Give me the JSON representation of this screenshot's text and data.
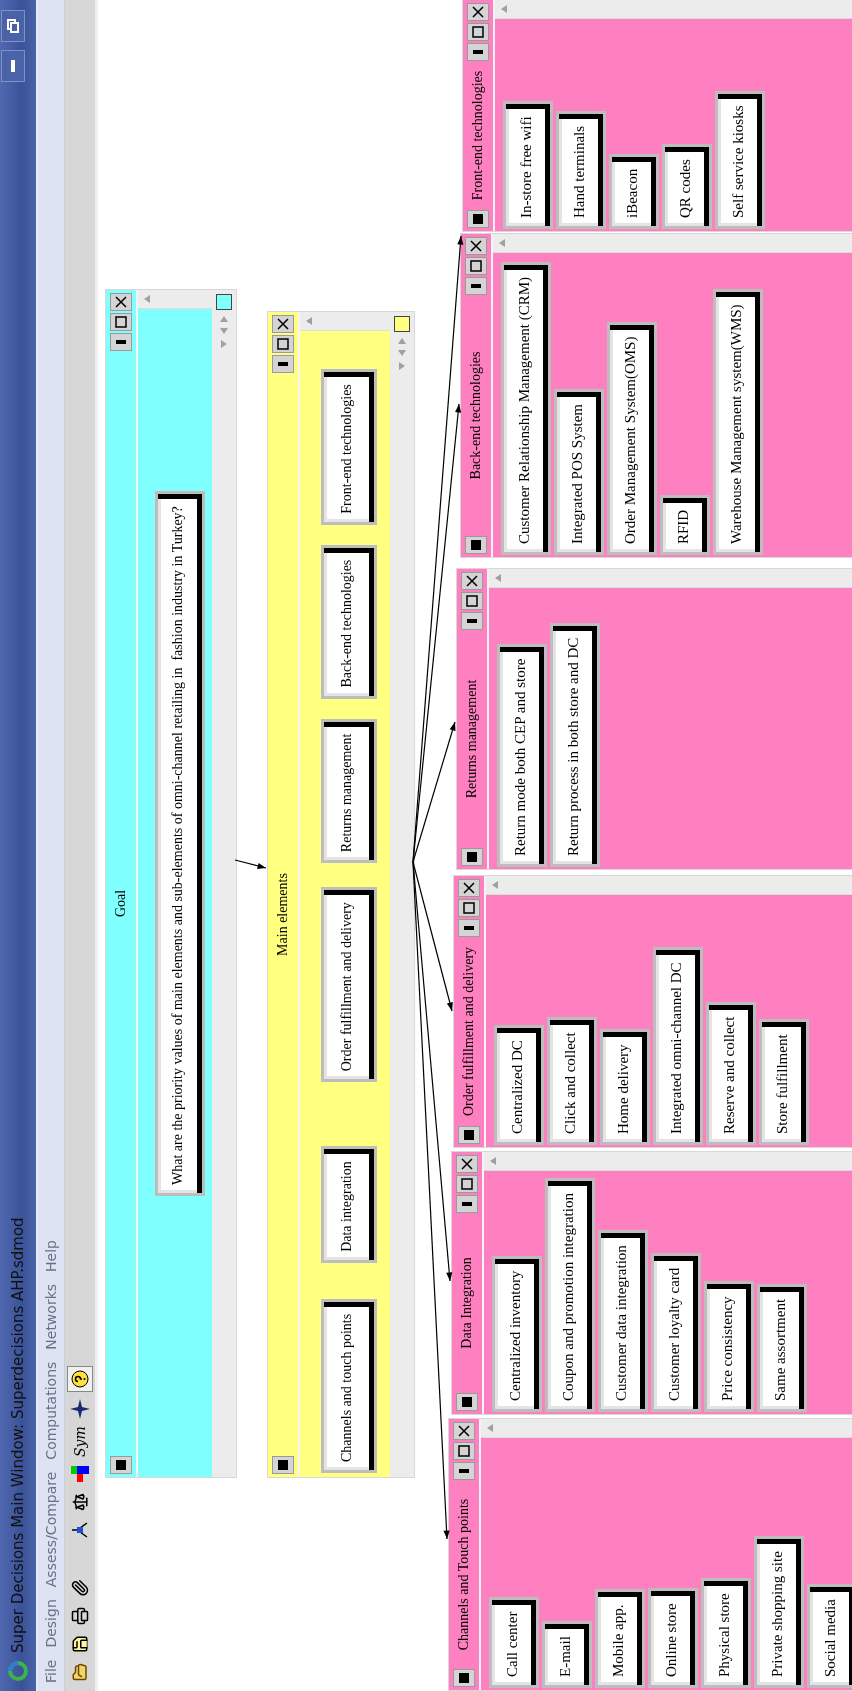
{
  "window": {
    "title": "Super Decisions Main Window: Superdecisions AHP.sdmod"
  },
  "menu": [
    "File",
    "Design",
    "Assess/Compare",
    "Computations",
    "Networks",
    "Help"
  ],
  "toolbar_label": "Sym",
  "clusters": [
    {
      "title": "Goal",
      "kind": "row",
      "color": "#80ffff",
      "nodes": [
        "What are the priority values of main elements and sub-elements of omni-channel retailing in  fashion industry in Turkey?"
      ]
    },
    {
      "title": "Main elements",
      "kind": "row",
      "color": "#ffff80",
      "nodes": [
        "Channels and touch points",
        "Data integration",
        "Order fulfillment and delivery",
        "Returns management",
        "Back-end technologies",
        "Front-end technologies"
      ]
    },
    {
      "title": "Channels and Touch points",
      "kind": "column",
      "color": "#ff80c0",
      "nodes": [
        "Call center",
        "E-mail",
        "Mobile app.",
        "Online store",
        "Physical store",
        "Private shopping site",
        "Social media"
      ]
    },
    {
      "title": "Data Integration",
      "kind": "column",
      "color": "#ff80c0",
      "nodes": [
        "Centralized inventory",
        "Coupon and promotion integration",
        "Customer data integration",
        "Customer loyalty card",
        "Price consistency",
        "Same assortment"
      ]
    },
    {
      "title": "Order fulfillment and delivery",
      "kind": "column",
      "color": "#ff80c0",
      "nodes": [
        "Centralized DC",
        "Click and collect",
        "Home delivery",
        "Integrated omni-channel DC",
        "Reserve and collect",
        "Store fulfillment"
      ]
    },
    {
      "title": "Returns management",
      "kind": "column",
      "color": "#ff80c0",
      "nodes": [
        "Return mode both CEP and store",
        "Return process in both store and DC"
      ]
    },
    {
      "title": "Back-end technologies",
      "kind": "column",
      "color": "#ff80c0",
      "nodes": [
        "Customer Relationship Management (CRM)",
        "Integrated POS System",
        "Order Management System(OMS)",
        "RFID",
        "Warehouse Management system(WMS)"
      ]
    },
    {
      "title": "Front-end technologies",
      "kind": "column",
      "color": "#ff80c0",
      "nodes": [
        "In-store free wifi",
        "Hand terminals",
        "iBeacon",
        "QR codes",
        "Self service kiosks"
      ]
    }
  ]
}
